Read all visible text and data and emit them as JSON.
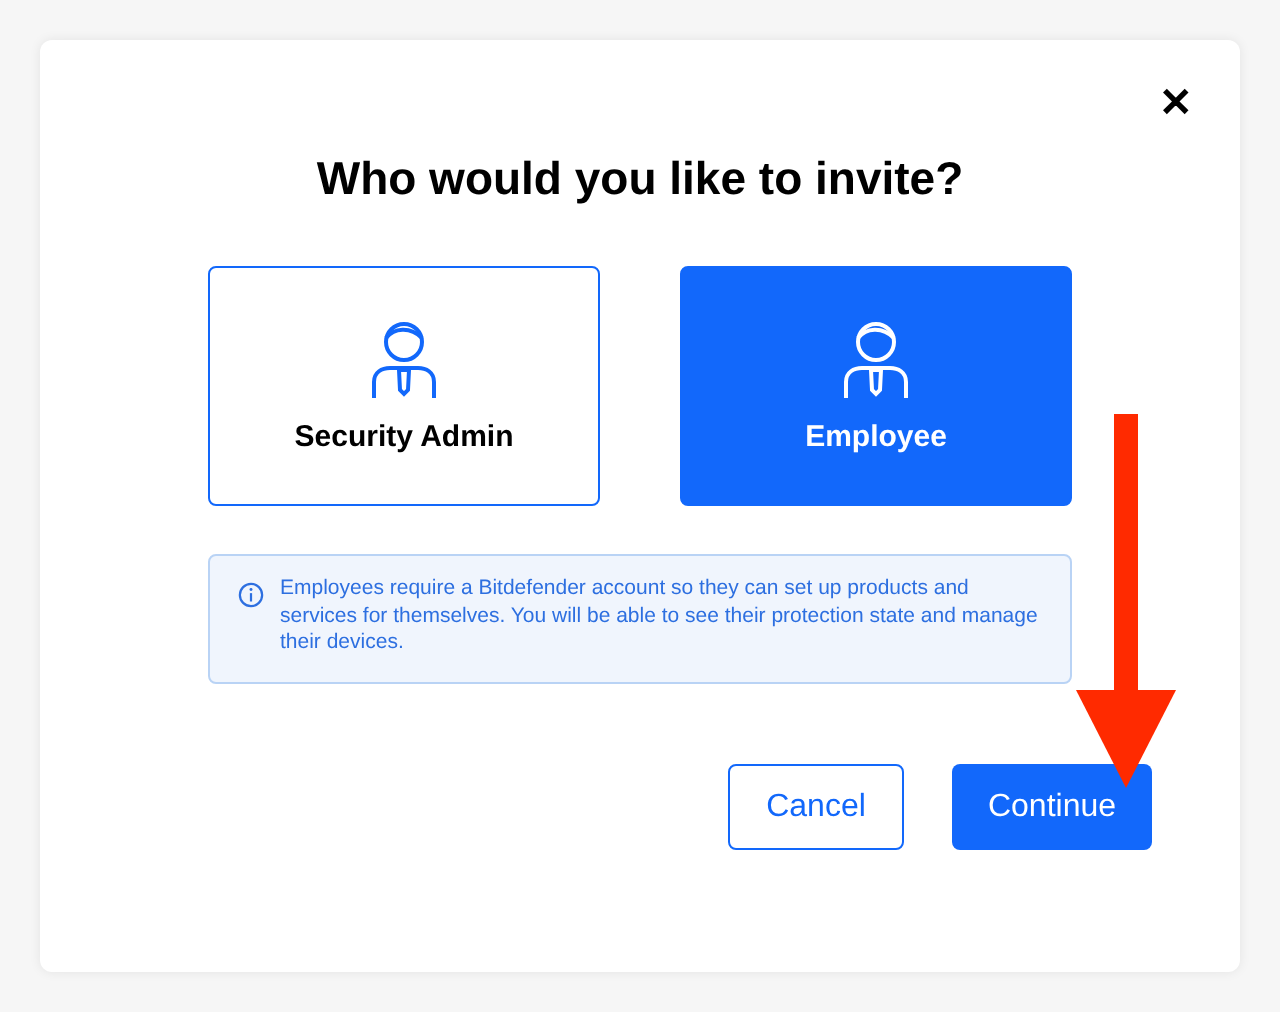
{
  "dialog": {
    "close_label": "✕",
    "title": "Who would you like to invite?"
  },
  "options": [
    {
      "label": "Security Admin",
      "selected": false
    },
    {
      "label": "Employee",
      "selected": true
    }
  ],
  "info": {
    "text": "Employees require a Bitdefender account so they can set up products and services for themselves. You will be able to see their protection state and manage their devices."
  },
  "buttons": [
    {
      "label": "Cancel",
      "kind": "secondary"
    },
    {
      "label": "Continue",
      "kind": "primary"
    }
  ]
}
